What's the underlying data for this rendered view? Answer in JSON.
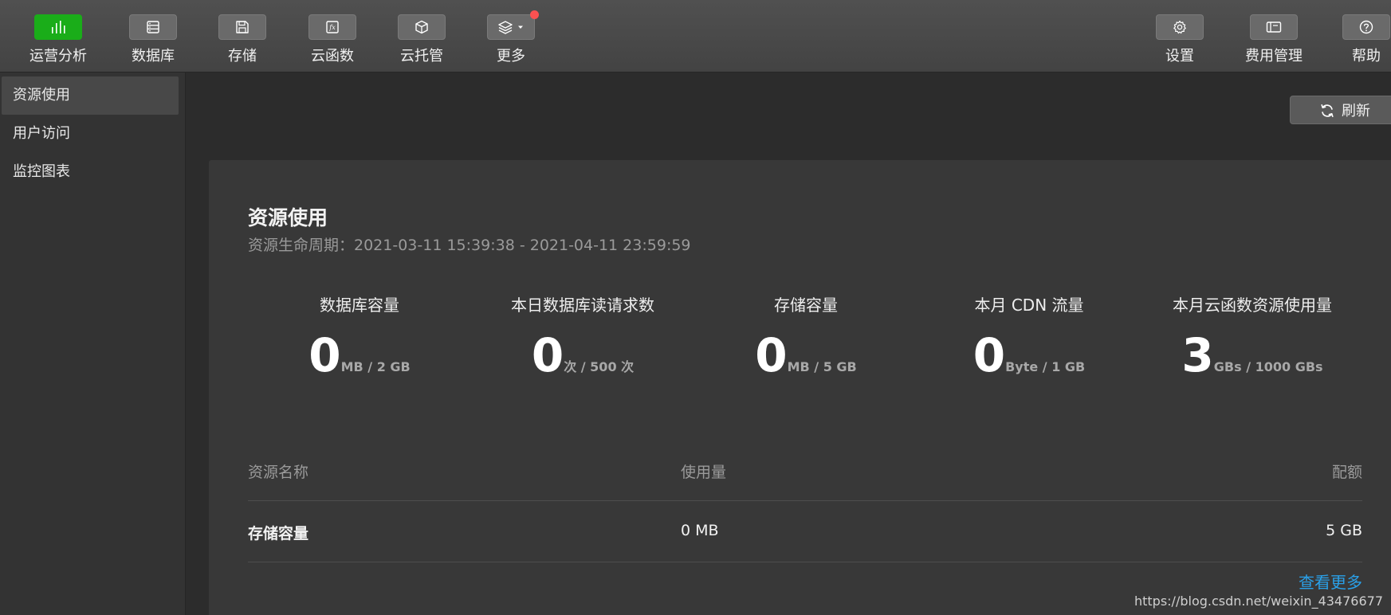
{
  "toolbar": {
    "left_items": [
      {
        "label": "运营分析",
        "icon": "bar-chart-icon",
        "active": true
      },
      {
        "label": "数据库",
        "icon": "database-icon",
        "active": false
      },
      {
        "label": "存储",
        "icon": "storage-icon",
        "active": false
      },
      {
        "label": "云函数",
        "icon": "function-icon",
        "active": false
      },
      {
        "label": "云托管",
        "icon": "box-icon",
        "active": false
      },
      {
        "label": "更多",
        "icon": "layers-icon",
        "active": false,
        "has_dropdown": true,
        "has_badge": true
      }
    ],
    "right_items": [
      {
        "label": "设置",
        "icon": "gear-icon"
      },
      {
        "label": "费用管理",
        "icon": "billing-icon"
      },
      {
        "label": "帮助",
        "icon": "help-icon"
      }
    ]
  },
  "sidebar": {
    "items": [
      {
        "label": "资源使用",
        "active": true
      },
      {
        "label": "用户访问",
        "active": false
      },
      {
        "label": "监控图表",
        "active": false
      }
    ]
  },
  "refresh": {
    "label": "刷新",
    "icon": "refresh-icon"
  },
  "panel": {
    "title": "资源使用",
    "lifecycle": "资源生命周期：2021-03-11 15:39:38 - 2021-04-11 23:59:59",
    "stats": [
      {
        "label": "数据库容量",
        "value": "0",
        "unit": "MB / 2 GB"
      },
      {
        "label": "本日数据库读请求数",
        "value": "0",
        "unit": "次 / 500 次"
      },
      {
        "label": "存储容量",
        "value": "0",
        "unit": "MB / 5 GB"
      },
      {
        "label": "本月 CDN 流量",
        "value": "0",
        "unit": "Byte / 1 GB"
      },
      {
        "label": "本月云函数资源使用量",
        "value": "3",
        "unit": "GBs / 1000 GBs"
      }
    ],
    "table": {
      "headers": [
        "资源名称",
        "使用量",
        "配额"
      ],
      "rows": [
        [
          "存储容量",
          "0 MB",
          "5 GB"
        ]
      ]
    },
    "view_more": "查看更多"
  },
  "watermark": "https://blog.csdn.net/weixin_43476677",
  "colors": {
    "accent_green": "#1aad19",
    "badge_red": "#fa5151",
    "link_blue": "#2aa0e8"
  }
}
